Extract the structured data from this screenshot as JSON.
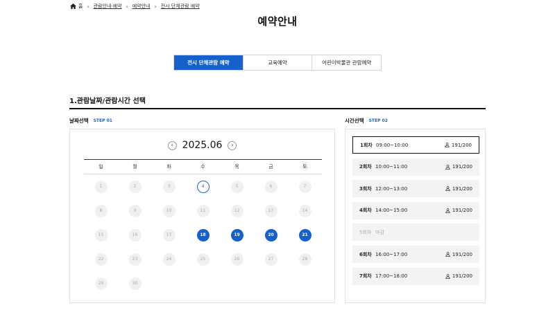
{
  "breadcrumb": {
    "home": "홈",
    "items": [
      "관람안내·예약",
      "예약안내",
      "전시 단체관람 예약"
    ]
  },
  "page_title": "예약안내",
  "tabs": [
    {
      "label": "전시 단체관람 예약",
      "active": true
    },
    {
      "label": "교육예약",
      "active": false
    },
    {
      "label": "어린이박물관 관람예약",
      "active": false
    }
  ],
  "section_title": "1.관람날짜/관람시간 선택",
  "date_section": {
    "label": "날짜선택",
    "step": "STEP 01"
  },
  "time_section": {
    "label": "시간선택",
    "step": "STEP 02"
  },
  "calendar": {
    "month": "2025.06",
    "prev_icon": "chevron-left-icon",
    "next_icon": "chevron-right-icon",
    "weekdays": [
      "일",
      "월",
      "화",
      "수",
      "목",
      "금",
      "토"
    ],
    "weeks": [
      [
        {
          "d": "1",
          "s": "disabled"
        },
        {
          "d": "2",
          "s": "disabled"
        },
        {
          "d": "3",
          "s": "disabled"
        },
        {
          "d": "4",
          "s": "today"
        },
        {
          "d": "5",
          "s": "disabled"
        },
        {
          "d": "6",
          "s": "disabled"
        },
        {
          "d": "7",
          "s": "disabled"
        }
      ],
      [
        {
          "d": "8",
          "s": "disabled"
        },
        {
          "d": "9",
          "s": "disabled"
        },
        {
          "d": "10",
          "s": "disabled"
        },
        {
          "d": "11",
          "s": "disabled"
        },
        {
          "d": "12",
          "s": "disabled"
        },
        {
          "d": "13",
          "s": "disabled"
        },
        {
          "d": "14",
          "s": "disabled"
        }
      ],
      [
        {
          "d": "15",
          "s": "disabled"
        },
        {
          "d": "16",
          "s": "disabled"
        },
        {
          "d": "17",
          "s": "disabled"
        },
        {
          "d": "18",
          "s": "available"
        },
        {
          "d": "19",
          "s": "available"
        },
        {
          "d": "20",
          "s": "available"
        },
        {
          "d": "21",
          "s": "available"
        }
      ],
      [
        {
          "d": "22",
          "s": "disabled"
        },
        {
          "d": "23",
          "s": "disabled"
        },
        {
          "d": "24",
          "s": "disabled"
        },
        {
          "d": "25",
          "s": "disabled"
        },
        {
          "d": "26",
          "s": "disabled"
        },
        {
          "d": "27",
          "s": "disabled"
        },
        {
          "d": "28",
          "s": "disabled"
        }
      ],
      [
        {
          "d": "29",
          "s": "disabled"
        },
        {
          "d": "30",
          "s": "disabled"
        },
        null,
        null,
        null,
        null,
        null
      ]
    ]
  },
  "time_slots": [
    {
      "round": "1회차",
      "time": "09:00~10:00",
      "capacity": "191/200",
      "state": "selected"
    },
    {
      "round": "2회차",
      "time": "10:00~11:00",
      "capacity": "191/200",
      "state": "open"
    },
    {
      "round": "3회차",
      "time": "12:00~13:00",
      "capacity": "191/200",
      "state": "open"
    },
    {
      "round": "4회차",
      "time": "14:00~15:00",
      "capacity": "191/200",
      "state": "open"
    },
    {
      "round": "5회차",
      "time": "마감",
      "capacity": "",
      "state": "closed"
    },
    {
      "round": "6회차",
      "time": "16:00~17:00",
      "capacity": "191/200",
      "state": "open"
    },
    {
      "round": "7회차",
      "time": "17:00~18:00",
      "capacity": "191/200",
      "state": "open"
    }
  ],
  "icons": {
    "home": "home-icon",
    "person": "person-icon",
    "separator": "chevron-right-icon"
  },
  "colors": {
    "accent": "#1660cc",
    "disabled_bg": "#f0f0f0",
    "slot_bg": "#f3f3f3"
  }
}
